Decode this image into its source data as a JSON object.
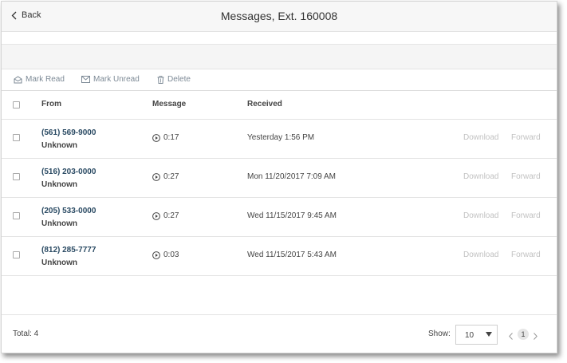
{
  "header": {
    "back_label": "Back",
    "title": "Messages, Ext. 160008"
  },
  "actions": {
    "mark_read": "Mark Read",
    "mark_unread": "Mark Unread",
    "delete": "Delete"
  },
  "table": {
    "columns": {
      "from": "From",
      "message": "Message",
      "received": "Received"
    },
    "rows": [
      {
        "phone": "(561) 569-9000",
        "caller": "Unknown",
        "duration": "0:17",
        "received": "Yesterday 1:56 PM",
        "download": "Download",
        "forward": "Forward"
      },
      {
        "phone": "(516) 203-0000",
        "caller": "Unknown",
        "duration": "0:27",
        "received": "Mon 11/20/2017 7:09 AM",
        "download": "Download",
        "forward": "Forward"
      },
      {
        "phone": "(205) 533-0000",
        "caller": "Unknown",
        "duration": "0:27",
        "received": "Wed 11/15/2017 9:45 AM",
        "download": "Download",
        "forward": "Forward"
      },
      {
        "phone": "(812) 285-7777",
        "caller": "Unknown",
        "duration": "0:03",
        "received": "Wed 11/15/2017 5:43 AM",
        "download": "Download",
        "forward": "Forward"
      }
    ]
  },
  "footer": {
    "total": "Total: 4",
    "show_label": "Show:",
    "page_size": "10",
    "current_page": "1"
  },
  "colors": {
    "phone_link": "#2a4a63",
    "action_text": "#7d8a96",
    "disabled_text": "#c2c2c2"
  }
}
